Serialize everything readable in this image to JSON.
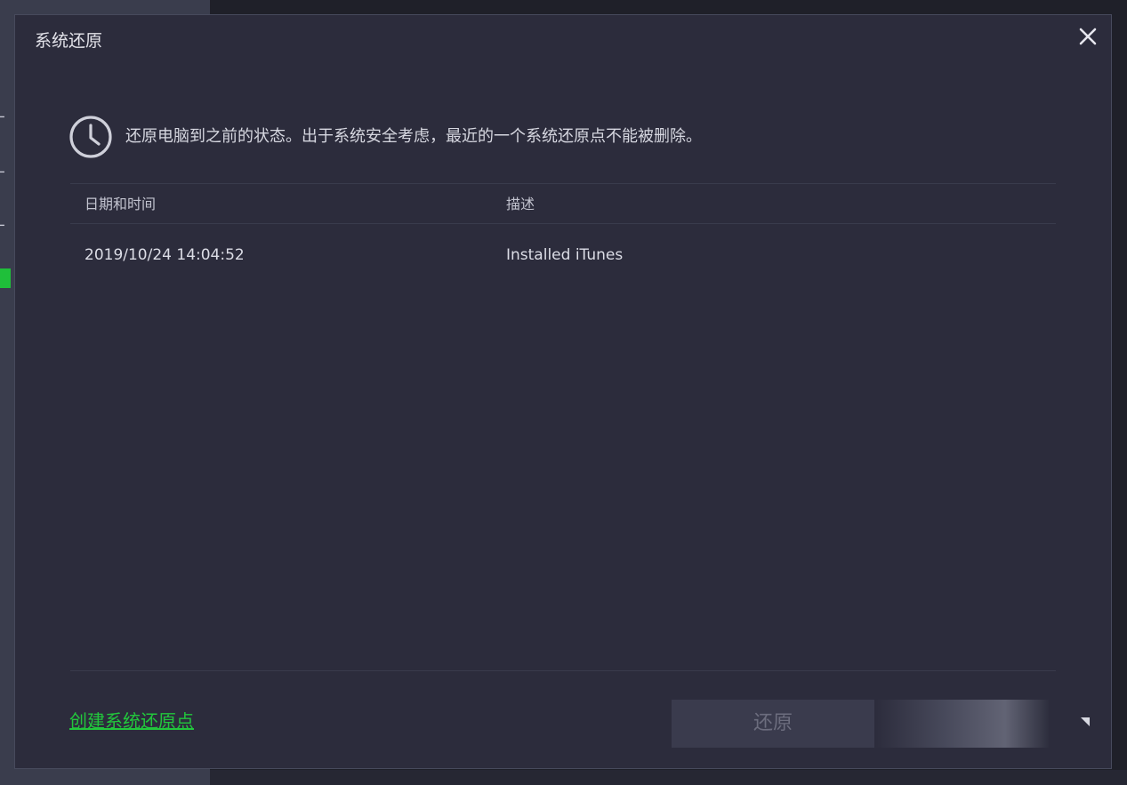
{
  "dialog": {
    "title": "系统还原",
    "intro": "还原电脑到之前的状态。出于系统安全考虑，最近的一个系统还原点不能被删除。",
    "table": {
      "columns": [
        "日期和时间",
        "描述"
      ],
      "rows": [
        {
          "datetime": "2019/10/24 14:04:52",
          "description": "Installed iTunes"
        }
      ]
    },
    "create_link": "创建系统还原点",
    "restore_button": "还原"
  },
  "icons": {
    "close": "close-icon",
    "clock": "clock-icon"
  },
  "colors": {
    "dialog_bg": "#2c2c3c",
    "link_green": "#22c63c",
    "text": "#d6d7e0"
  }
}
